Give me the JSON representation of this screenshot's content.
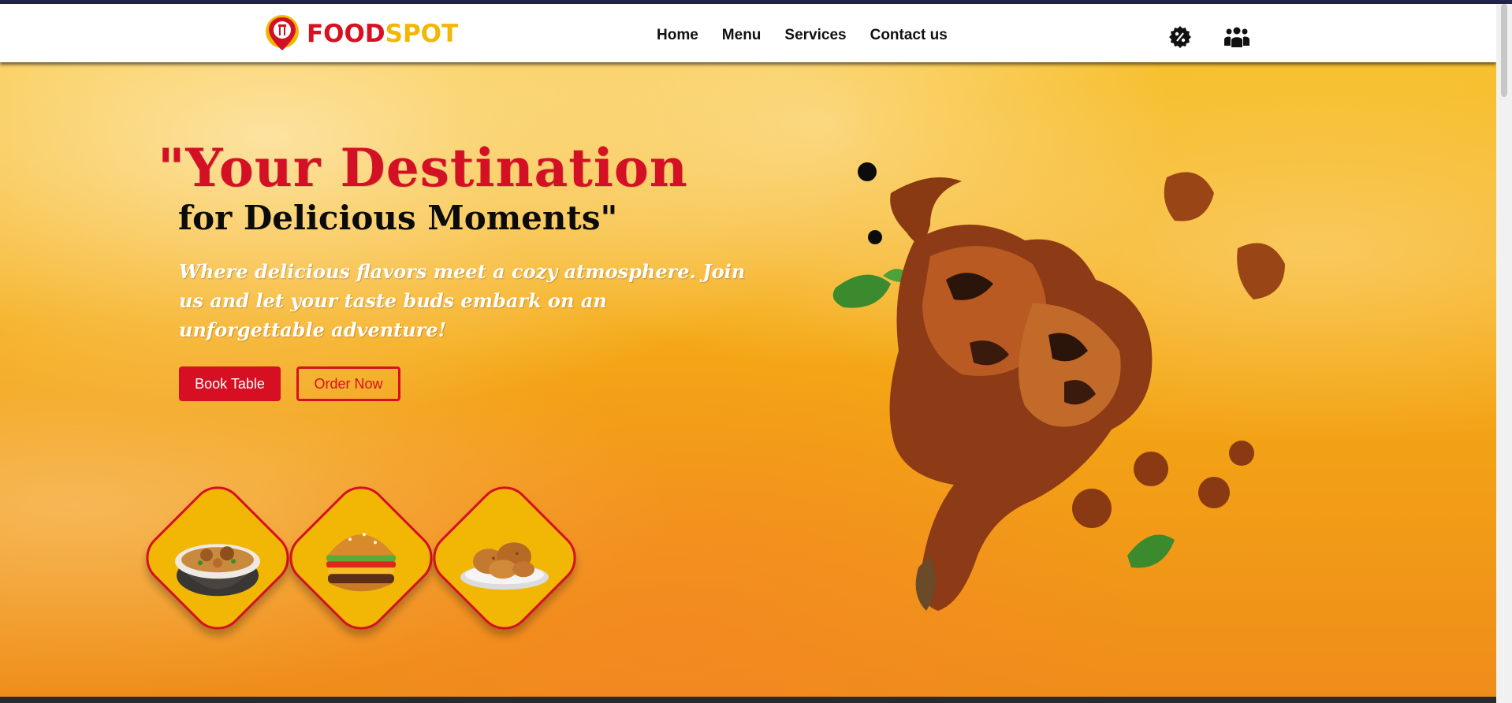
{
  "brand": {
    "name_part1": "FOOD",
    "name_part2": "SPOT",
    "primary_color": "#d41024",
    "accent_color": "#f2b705"
  },
  "nav": {
    "links": [
      "Home",
      "Menu",
      "Services",
      "Contact us"
    ],
    "icons": [
      "discount-badge-icon",
      "group-people-icon"
    ]
  },
  "hero": {
    "headline_line1": "\"Your Destination",
    "headline_line2": "for Delicious Moments\"",
    "tagline": "Where delicious flavors meet a cozy atmosphere. Join us and let your taste buds embark on an unforgettable adventure!",
    "buttons": {
      "book": "Book Table",
      "order": "Order Now"
    },
    "dishes": [
      "biryani-bowl",
      "burger",
      "fried-chicken-plate"
    ],
    "feature_image": "grilled-chicken"
  }
}
